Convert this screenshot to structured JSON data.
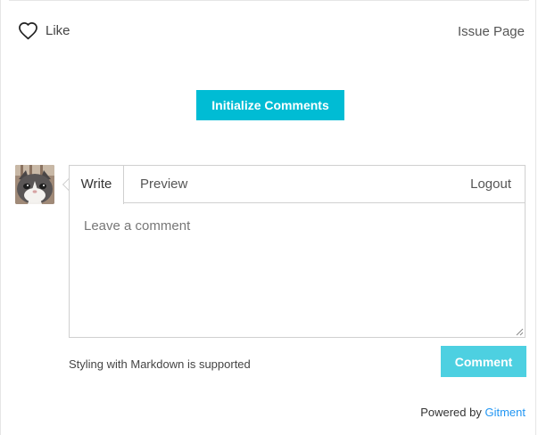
{
  "header": {
    "like_label": "Like",
    "issue_link": "Issue Page"
  },
  "init_button": "Initialize Comments",
  "editor": {
    "tabs": [
      "Write",
      "Preview"
    ],
    "logout": "Logout",
    "placeholder": "Leave a comment",
    "value": ""
  },
  "footer": {
    "markdown_note": "Styling with Markdown is supported",
    "comment_button": "Comment",
    "powered_by": "Powered by",
    "powered_link": "Gitment"
  },
  "colors": {
    "accent": "#00bcd4",
    "accent_disabled": "#4dd0e1",
    "link": "#2196f3"
  }
}
